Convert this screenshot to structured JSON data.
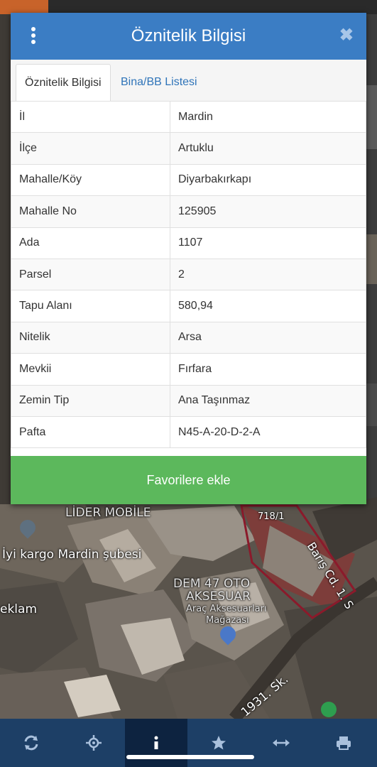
{
  "dialog": {
    "title": "Öznitelik Bilgisi",
    "close_glyph": "✖",
    "tabs": [
      {
        "label": "Öznitelik Bilgisi",
        "active": true
      },
      {
        "label": "Bina/BB Listesi",
        "active": false
      }
    ],
    "rows": [
      {
        "key": "İl",
        "value": "Mardin"
      },
      {
        "key": "İlçe",
        "value": "Artuklu"
      },
      {
        "key": "Mahalle/Köy",
        "value": "Diyarbakırkapı"
      },
      {
        "key": "Mahalle No",
        "value": "125905"
      },
      {
        "key": "Ada",
        "value": "1107"
      },
      {
        "key": "Parsel",
        "value": "2"
      },
      {
        "key": "Tapu Alanı",
        "value": "580,94"
      },
      {
        "key": "Nitelik",
        "value": "Arsa"
      },
      {
        "key": "Mevkii",
        "value": "Fırfara"
      },
      {
        "key": "Zemin Tip",
        "value": "Ana Taşınmaz"
      },
      {
        "key": "Pafta",
        "value": "N45-A-20-D-2-A"
      }
    ],
    "favorite_button": "Favorilere ekle"
  },
  "map": {
    "labels": {
      "lider": "LİDER MOBİLE",
      "parcel": "718/1",
      "street_baris": "Barış Cd. 1. S",
      "kargo": "İyi kargo Mardin şubesi",
      "dem1": "DEM 47 OTO",
      "dem2": "AKSESUAR",
      "dem3": "Araç Aksesuarları",
      "dem4": "Mağazası",
      "eklam": "eklam",
      "street_1931": "1931. Sk."
    }
  },
  "toolbar": {
    "buttons": [
      {
        "icon": "refresh-icon",
        "active": false
      },
      {
        "icon": "locate-icon",
        "active": false
      },
      {
        "icon": "info-icon",
        "active": true
      },
      {
        "icon": "star-icon",
        "active": false
      },
      {
        "icon": "measure-icon",
        "active": false
      },
      {
        "icon": "print-icon",
        "active": false
      }
    ]
  },
  "colors": {
    "header": "#3b7dc4",
    "favorite": "#5cb85c",
    "toolbar": "#1d3f66",
    "toolbar_active": "#0d2340",
    "tab_link": "#2f74b9"
  }
}
